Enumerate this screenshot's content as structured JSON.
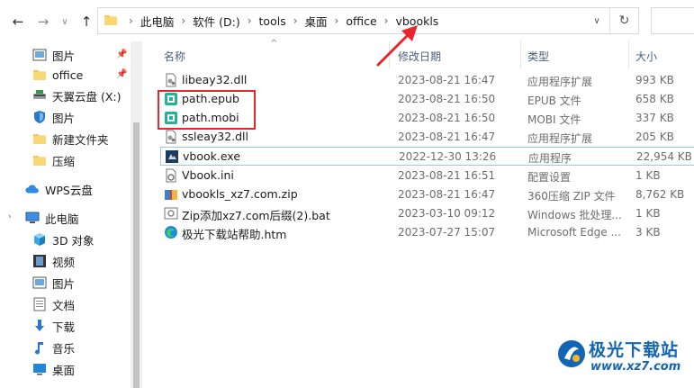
{
  "nav": {
    "back": "←",
    "forward": "→",
    "recent": "∨",
    "up": "↑"
  },
  "address": {
    "breadcrumbs": [
      "此电脑",
      "软件 (D:)",
      "tools",
      "桌面",
      "office",
      "vbookls"
    ],
    "separator": "›",
    "dropdown": "∨",
    "refresh": "↻"
  },
  "sidebar": {
    "items": [
      {
        "label": "图片",
        "icon": "pictures-icon",
        "pinned": true
      },
      {
        "label": "office",
        "icon": "folder-icon",
        "pinned": true
      },
      {
        "label": "天翼云盘 (X:)",
        "icon": "cloud-drive-icon",
        "pinned": false
      },
      {
        "label": "图片",
        "icon": "pictures-shield-icon",
        "pinned": false
      },
      {
        "label": "新建文件夹",
        "icon": "folder-icon",
        "pinned": false
      },
      {
        "label": "压缩",
        "icon": "folder-icon",
        "pinned": false
      },
      {
        "label": "WPS云盘",
        "icon": "wps-cloud-icon",
        "pinned": false
      },
      {
        "label": "此电脑",
        "icon": "this-pc-icon",
        "pinned": false
      },
      {
        "label": "3D 对象",
        "icon": "3d-objects-icon",
        "pinned": false
      },
      {
        "label": "视频",
        "icon": "videos-icon",
        "pinned": false
      },
      {
        "label": "图片",
        "icon": "pictures-icon",
        "pinned": false
      },
      {
        "label": "文档",
        "icon": "documents-icon",
        "pinned": false
      },
      {
        "label": "下载",
        "icon": "downloads-icon",
        "pinned": false
      },
      {
        "label": "音乐",
        "icon": "music-icon",
        "pinned": false
      },
      {
        "label": "桌面",
        "icon": "desktop-icon",
        "pinned": false
      }
    ]
  },
  "columns": {
    "name": "名称",
    "date": "修改日期",
    "type": "类型",
    "size": "大小"
  },
  "files": [
    {
      "name": "libeay32.dll",
      "date": "2023-08-21 16:47",
      "type": "应用程序扩展",
      "size": "993 KB",
      "icon": "dll-icon"
    },
    {
      "name": "path.epub",
      "date": "2023-08-21 16:50",
      "type": "EPUB 文件",
      "size": "658 KB",
      "icon": "epub-icon"
    },
    {
      "name": "path.mobi",
      "date": "2023-08-21 16:50",
      "type": "MOBI 文件",
      "size": "337 KB",
      "icon": "mobi-icon"
    },
    {
      "name": "ssleay32.dll",
      "date": "2023-08-21 16:47",
      "type": "应用程序扩展",
      "size": "205 KB",
      "icon": "dll-icon"
    },
    {
      "name": "vbook.exe",
      "date": "2022-12-30 13:26",
      "type": "应用程序",
      "size": "22,954 KB",
      "icon": "exe-icon"
    },
    {
      "name": "Vbook.ini",
      "date": "2023-08-21 16:51",
      "type": "配置设置",
      "size": "1 KB",
      "icon": "ini-icon"
    },
    {
      "name": "vbookls_xz7.com.zip",
      "date": "2023-08-21 16:47",
      "type": "360压缩 ZIP 文件",
      "size": "8,762 KB",
      "icon": "zip-icon"
    },
    {
      "name": "Zip添加xz7.com后缀(2).bat",
      "date": "2023-03-10 09:12",
      "type": "Windows 批处理...",
      "size": "1 KB",
      "icon": "bat-icon"
    },
    {
      "name": "极光下载站帮助.htm",
      "date": "2023-07-27 15:07",
      "type": "Microsoft Edge ...",
      "size": "3 KB",
      "icon": "edge-htm-icon"
    }
  ],
  "watermark": {
    "title": "极光下载站",
    "url": "www.xz7.com"
  },
  "colors": {
    "highlight": "#e8262b",
    "selection_border": "#99c9ef",
    "header_text": "#4c607a",
    "watermark": "#1464b4"
  }
}
